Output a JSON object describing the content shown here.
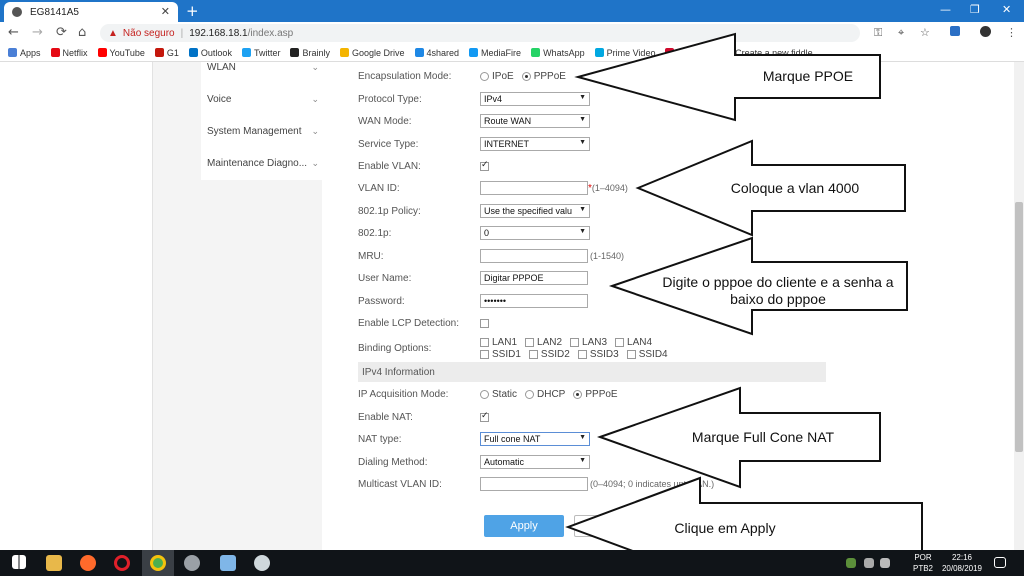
{
  "browser": {
    "tab_title": "EG8141A5",
    "close_glyph": "✕",
    "new_tab_glyph": "+",
    "nav": {
      "back": "←",
      "forward": "→",
      "reload": "⟳",
      "home": "⌂"
    },
    "address": {
      "warning_glyph": "▲",
      "security_label": "Não seguro",
      "separator": "|",
      "host": "192.168.18.1",
      "path": "/index.asp"
    },
    "window_controls": {
      "minimize": "—",
      "restore": "❐",
      "close": "✕"
    },
    "toolbar_icons": {
      "key": "⚿",
      "translate": "⌖",
      "star": "☆",
      "menu": "⋮"
    },
    "bookmarks": [
      {
        "label": "Apps",
        "color": "#4a7fd6"
      },
      {
        "label": "Netflix",
        "color": "#e50914"
      },
      {
        "label": "YouTube",
        "color": "#ff0000"
      },
      {
        "label": "G1",
        "color": "#c4170c"
      },
      {
        "label": "Outlook",
        "color": "#0072c6"
      },
      {
        "label": "Twitter",
        "color": "#1da1f2"
      },
      {
        "label": "Brainly",
        "color": "#222222"
      },
      {
        "label": "Google Drive",
        "color": "#f4b400"
      },
      {
        "label": "4shared",
        "color": "#1e88e5"
      },
      {
        "label": "MediaFire",
        "color": "#1299f3"
      },
      {
        "label": "WhatsApp",
        "color": "#25d366"
      },
      {
        "label": "Prime Video",
        "color": "#00a8e1"
      },
      {
        "label": "HUAWEI",
        "color": "#cf0a2c"
      },
      {
        "label": "Create a new fiddle...",
        "color": "#6aa84f"
      }
    ]
  },
  "sidebar": {
    "items": [
      {
        "label": "WLAN"
      },
      {
        "label": "Voice"
      },
      {
        "label": "System Management"
      },
      {
        "label": "Maintenance Diagno..."
      }
    ],
    "chevron": "⌄"
  },
  "form": {
    "encapsulation": {
      "label": "Encapsulation Mode:",
      "options": [
        "IPoE",
        "PPPoE"
      ],
      "selected": "PPPoE"
    },
    "protocol_type": {
      "label": "Protocol Type:",
      "value": "IPv4"
    },
    "wan_mode": {
      "label": "WAN Mode:",
      "value": "Route WAN"
    },
    "service_type": {
      "label": "Service Type:",
      "value": "INTERNET"
    },
    "enable_vlan": {
      "label": "Enable VLAN:",
      "checked": true
    },
    "vlan_id": {
      "label": "VLAN ID:",
      "value": "",
      "required": "*",
      "hint": "(1–4094)"
    },
    "policy_8021p": {
      "label": "802.1p Policy:",
      "value": "Use the specified valu"
    },
    "p_8021p": {
      "label": "802.1p:",
      "value": "0"
    },
    "mru": {
      "label": "MRU:",
      "value": "",
      "hint": "(1-1540)"
    },
    "user_name": {
      "label": "User Name:",
      "value": "Digitar PPPOE"
    },
    "password": {
      "label": "Password:",
      "value": "•••••••"
    },
    "lcp_detection": {
      "label": "Enable LCP Detection:",
      "checked": false
    },
    "binding": {
      "label": "Binding Options:",
      "lan": [
        "LAN1",
        "LAN2",
        "LAN3",
        "LAN4"
      ],
      "ssid": [
        "SSID1",
        "SSID2",
        "SSID3",
        "SSID4"
      ]
    },
    "ipv4_section": "IPv4 Information",
    "ip_acquisition": {
      "label": "IP Acquisition Mode:",
      "options": [
        "Static",
        "DHCP",
        "PPPoE"
      ],
      "selected": "PPPoE"
    },
    "enable_nat": {
      "label": "Enable NAT:",
      "checked": true
    },
    "nat_type": {
      "label": "NAT type:",
      "value": "Full cone NAT"
    },
    "dialing": {
      "label": "Dialing Method:",
      "value": "Automatic"
    },
    "multicast_vlan": {
      "label": "Multicast VLAN ID:",
      "value": "",
      "hint": "(0–4094; 0 indicates untag",
      "hint_tail": "AN.)"
    },
    "apply_label": "Apply"
  },
  "annotations": [
    {
      "text": "Marque PPOE"
    },
    {
      "text": "Coloque a vlan 4000"
    },
    {
      "text": "Digite o pppoe do cliente e a senha a baixo do pppoe"
    },
    {
      "text": "Marque Full Cone NAT"
    },
    {
      "text": "Clique em Apply"
    }
  ],
  "taskbar": {
    "language": "POR",
    "keyboard": "PTB2",
    "time": "22:16",
    "date": "20/08/2019"
  }
}
